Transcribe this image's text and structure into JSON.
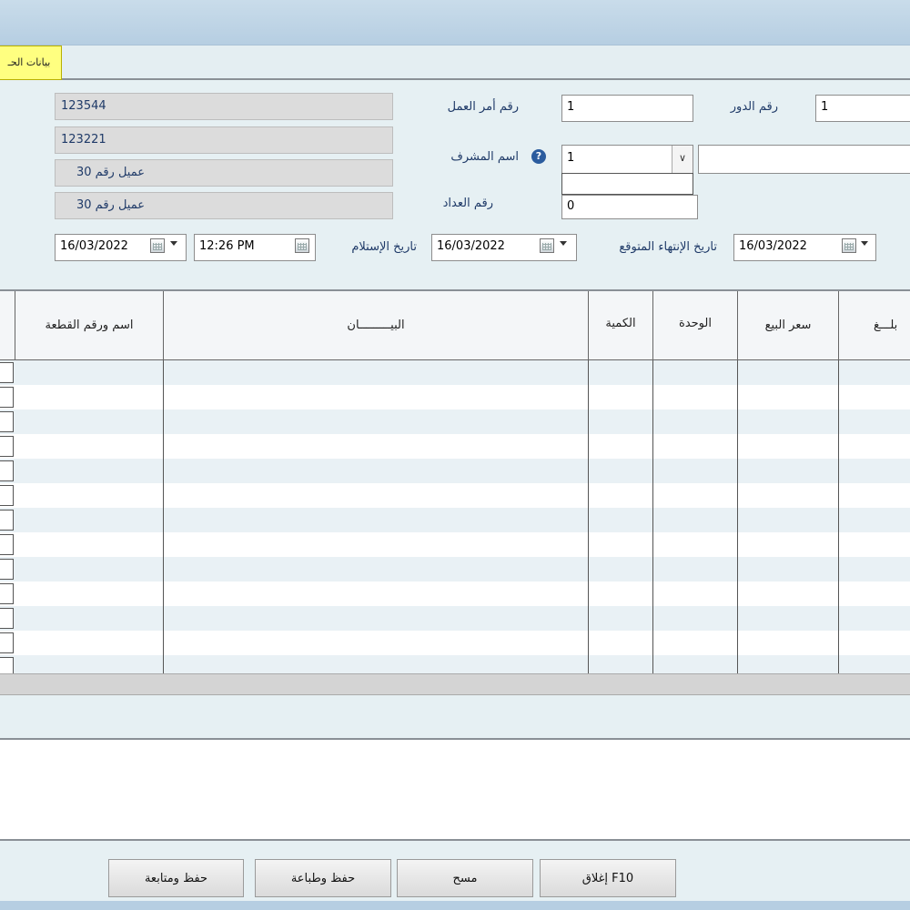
{
  "tab": {
    "label": "بيانات الحـ"
  },
  "customer": {
    "field1": "123544",
    "field2": "123221",
    "field3": "عميل رقم 30",
    "field4": "عميل رقم 30"
  },
  "form": {
    "work_order_label": "رقم أمر العمل",
    "work_order_value": "1",
    "turn_label": "رقم الدور",
    "turn_value": "1",
    "supervisor_label": "اسم المشرف",
    "supervisor_value": "1",
    "counter_label": "رقم العداد",
    "counter_value": "0",
    "receive_date_label": "تاريخ الإستلام",
    "expected_end_label": "تاريخ الإنتهاء المتوقع",
    "date1": "16/03/2022",
    "time1": "12:26 PM",
    "date2": "16/03/2022",
    "date3": "16/03/2022"
  },
  "grid": {
    "columns": [
      "اسم ورقم القطعة",
      "البيـــــــــان",
      "الكمية",
      "الوحدة",
      "سعر البيع",
      "بلـــغ"
    ]
  },
  "buttons": {
    "close": "F10 إغلاق",
    "clear": "مسح",
    "save_print": "حفظ وطباعة",
    "save_continue": "حفظ ومتابعة"
  }
}
